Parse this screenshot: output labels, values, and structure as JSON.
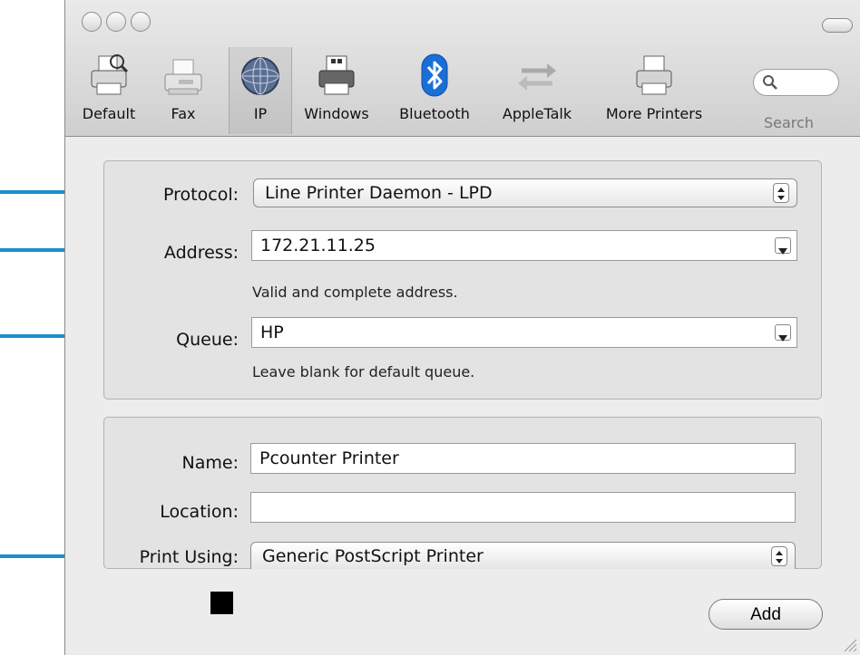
{
  "toolbar": {
    "items": [
      {
        "label": "Default",
        "icon": "default-printer-icon"
      },
      {
        "label": "Fax",
        "icon": "fax-icon"
      },
      {
        "label": "IP",
        "icon": "ip-globe-icon"
      },
      {
        "label": "Windows",
        "icon": "windows-printer-icon"
      },
      {
        "label": "Bluetooth",
        "icon": "bluetooth-icon"
      },
      {
        "label": "AppleTalk",
        "icon": "appletalk-arrows-icon"
      },
      {
        "label": "More Printers",
        "icon": "more-printers-icon"
      }
    ],
    "selected": "IP",
    "search_label": "Search"
  },
  "ip_group": {
    "protocol_label": "Protocol:",
    "protocol_value": "Line Printer Daemon - LPD",
    "address_label": "Address:",
    "address_value": "172.21.11.25",
    "address_hint": "Valid and complete address.",
    "queue_label": "Queue:",
    "queue_value": "HP",
    "queue_hint": "Leave blank for default queue."
  },
  "printer_group": {
    "name_label": "Name:",
    "name_value": "Pcounter Printer",
    "location_label": "Location:",
    "location_value": "",
    "print_using_label": "Print Using:",
    "print_using_value": "Generic PostScript Printer"
  },
  "buttons": {
    "add_label": "Add"
  },
  "colors": {
    "annotation_arrow": "#1a8fd0",
    "bluetooth": "#1a6fd6"
  }
}
